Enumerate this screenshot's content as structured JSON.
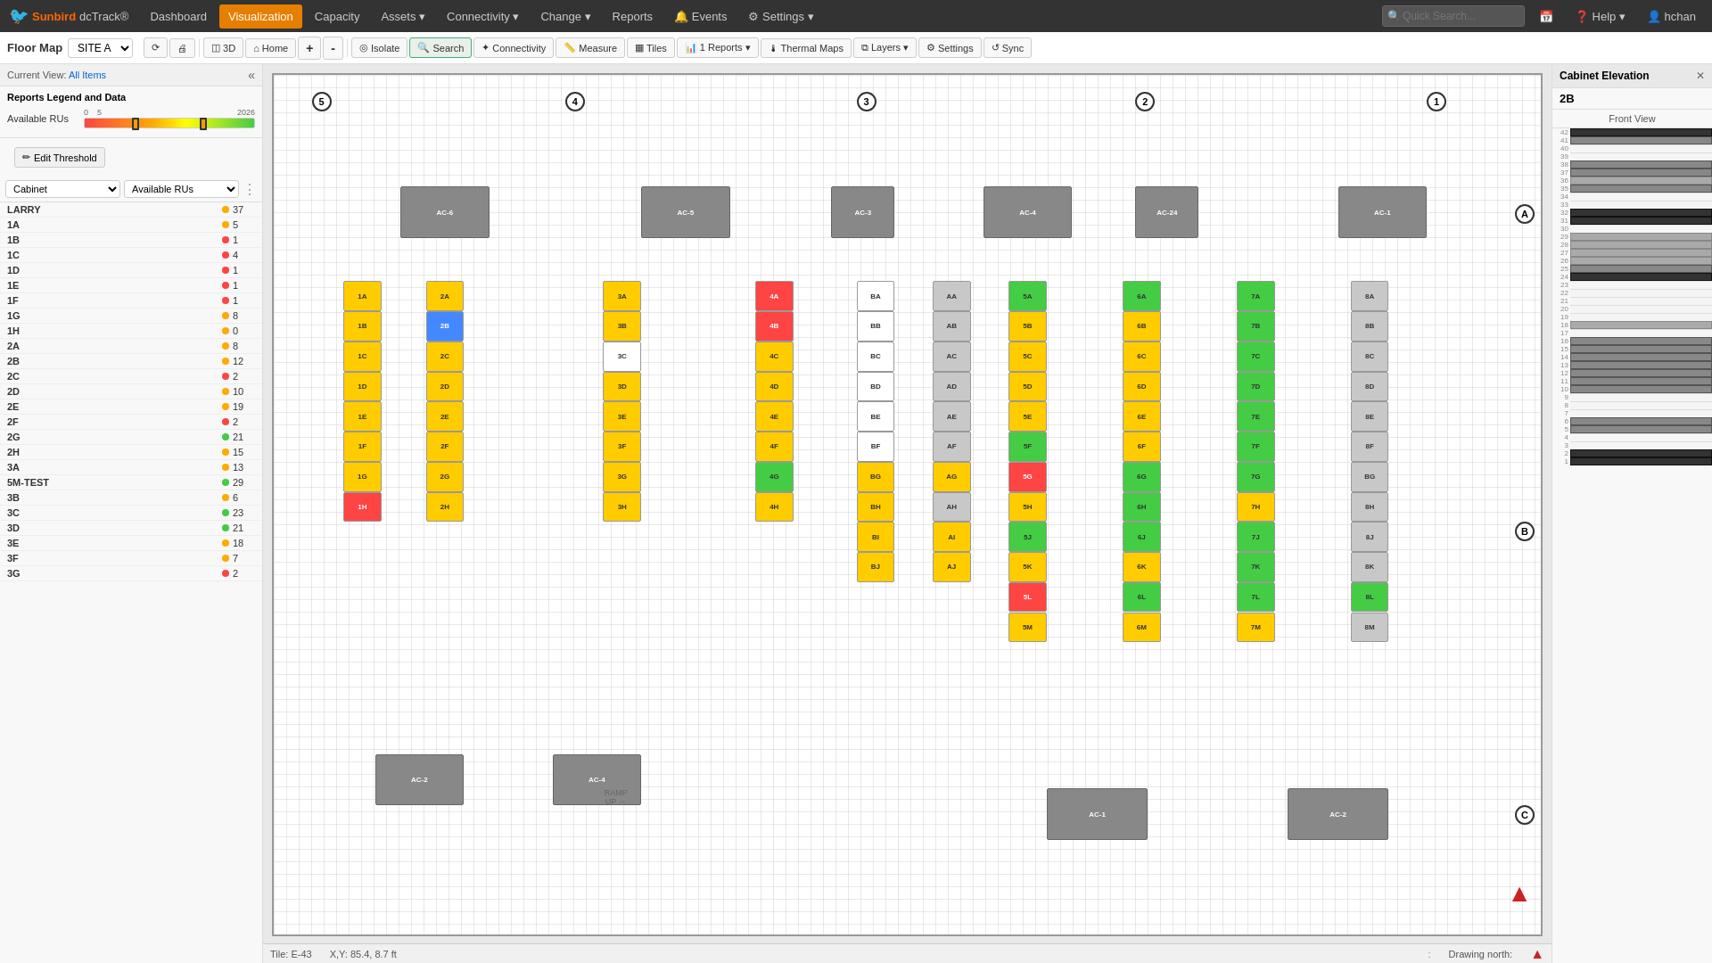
{
  "app": {
    "logo_bird": "🐦",
    "logo_brand": "Sunbird",
    "logo_sub": "dcTrack®"
  },
  "top_nav": {
    "items": [
      {
        "id": "dashboard",
        "label": "Dashboard",
        "active": false
      },
      {
        "id": "visualization",
        "label": "Visualization",
        "active": true
      },
      {
        "id": "capacity",
        "label": "Capacity",
        "active": false
      },
      {
        "id": "assets",
        "label": "Assets",
        "active": false,
        "has_dropdown": true
      },
      {
        "id": "connectivity",
        "label": "Connectivity",
        "active": false,
        "has_dropdown": true
      },
      {
        "id": "change",
        "label": "Change",
        "active": false,
        "has_dropdown": true
      },
      {
        "id": "reports",
        "label": "Reports",
        "active": false
      },
      {
        "id": "events",
        "label": "Events",
        "active": false
      },
      {
        "id": "settings",
        "label": "Settings",
        "active": false,
        "has_dropdown": true
      }
    ],
    "search_placeholder": "Quick Search...",
    "help_label": "Help",
    "user_label": "hchan"
  },
  "toolbar": {
    "floor_map_label": "Floor Map",
    "site_value": "SITE A",
    "buttons": [
      {
        "id": "refresh",
        "label": "",
        "icon": "⟳"
      },
      {
        "id": "print",
        "label": "",
        "icon": "🖨"
      },
      {
        "id": "3d",
        "label": "3D",
        "icon": "◫"
      },
      {
        "id": "home",
        "label": "Home",
        "icon": "⌂"
      },
      {
        "id": "zoom-in",
        "label": "",
        "icon": "+"
      },
      {
        "id": "zoom-out",
        "label": "",
        "icon": "-"
      },
      {
        "id": "isolate",
        "label": "Isolate",
        "icon": "◎"
      },
      {
        "id": "search",
        "label": "Search",
        "icon": "🔍"
      },
      {
        "id": "connectivity",
        "label": "Connectivity",
        "icon": "✦"
      },
      {
        "id": "measure",
        "label": "Measure",
        "icon": "📏"
      },
      {
        "id": "tiles",
        "label": "Tiles",
        "icon": "▦"
      },
      {
        "id": "reports",
        "label": "1 Reports",
        "icon": "📊",
        "has_dropdown": true
      },
      {
        "id": "thermal-maps",
        "label": "Thermal Maps",
        "icon": "🌡"
      },
      {
        "id": "layers",
        "label": "Layers",
        "icon": "⧉",
        "has_dropdown": true
      },
      {
        "id": "settings",
        "label": "Settings",
        "icon": "⚙"
      },
      {
        "id": "sync",
        "label": "Sync",
        "icon": "↺"
      }
    ]
  },
  "left_panel": {
    "current_view_label": "Current View:",
    "current_view_value": "All Items",
    "legend_title": "Reports Legend and Data",
    "legend_items": [
      {
        "label": "Available RUs",
        "markers": [
          "0",
          "5",
          "20",
          "26"
        ],
        "marker1_pct": 30,
        "marker2_pct": 68
      }
    ],
    "edit_threshold_label": "Edit Threshold",
    "filter1_value": "Cabinet",
    "filter2_value": "Available RUs",
    "cabinets": [
      {
        "name": "LARRY",
        "dot": "yellow",
        "value": "37"
      },
      {
        "name": "1A",
        "dot": "yellow",
        "value": "5"
      },
      {
        "name": "1B",
        "dot": "red",
        "value": "1"
      },
      {
        "name": "1C",
        "dot": "red",
        "value": "4"
      },
      {
        "name": "1D",
        "dot": "red",
        "value": "1"
      },
      {
        "name": "1E",
        "dot": "red",
        "value": "1"
      },
      {
        "name": "1F",
        "dot": "red",
        "value": "1"
      },
      {
        "name": "1G",
        "dot": "yellow",
        "value": "8"
      },
      {
        "name": "1H",
        "dot": "yellow",
        "value": "0"
      },
      {
        "name": "2A",
        "dot": "yellow",
        "value": "8"
      },
      {
        "name": "2B",
        "dot": "yellow",
        "value": "12"
      },
      {
        "name": "2C",
        "dot": "red",
        "value": "2"
      },
      {
        "name": "2D",
        "dot": "yellow",
        "value": "10"
      },
      {
        "name": "2E",
        "dot": "yellow",
        "value": "19"
      },
      {
        "name": "2F",
        "dot": "red",
        "value": "2"
      },
      {
        "name": "2G",
        "dot": "green",
        "value": "21"
      },
      {
        "name": "2H",
        "dot": "yellow",
        "value": "15"
      },
      {
        "name": "3A",
        "dot": "yellow",
        "value": "13"
      },
      {
        "name": "5M-TEST",
        "dot": "green",
        "value": "29"
      },
      {
        "name": "3B",
        "dot": "yellow",
        "value": "6"
      },
      {
        "name": "3C",
        "dot": "green",
        "value": "23"
      },
      {
        "name": "3D",
        "dot": "green",
        "value": "21"
      },
      {
        "name": "3E",
        "dot": "yellow",
        "value": "18"
      },
      {
        "name": "3F",
        "dot": "yellow",
        "value": "7"
      },
      {
        "name": "3G",
        "dot": "red",
        "value": "2"
      }
    ]
  },
  "floor_plan": {
    "column_labels": [
      "5",
      "4",
      "3",
      "2",
      "1"
    ],
    "row_labels": [
      "A",
      "B",
      "C"
    ],
    "tile_info": "Tile: E-43",
    "xy_info": "X,Y: 85.4, 8.7 ft",
    "drawing_north": "Drawing north:"
  },
  "right_panel": {
    "title": "Cabinet Elevation",
    "cabinet_id": "2B",
    "view_label": "Front View",
    "ru_count": 42
  },
  "status_bar": {
    "tile": "Tile: E-43",
    "xy": "X,Y: 85.4, 8.7 ft",
    "drawing_north": "Drawing north:"
  }
}
